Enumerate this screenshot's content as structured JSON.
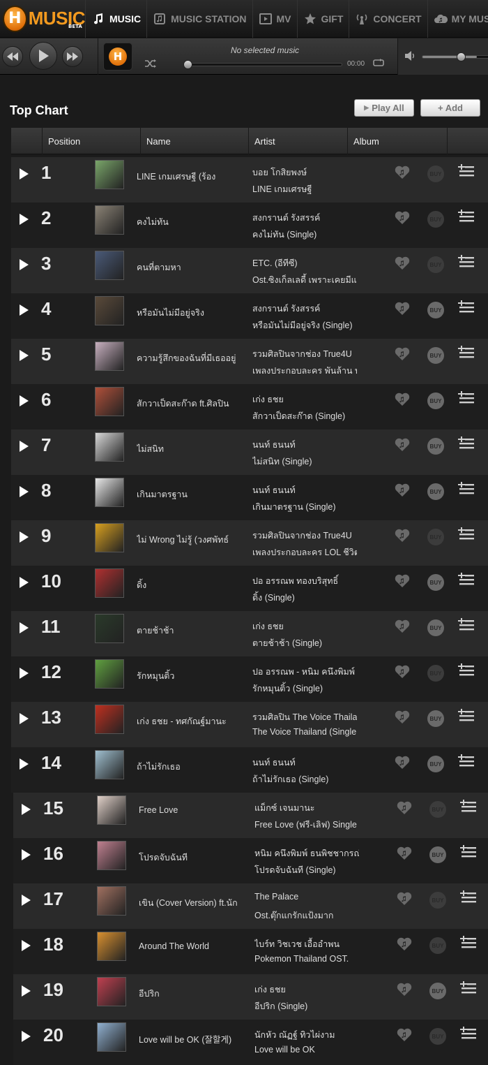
{
  "nav": {
    "logo_text": "MUSIC",
    "logo_badge": "BETA",
    "items": [
      {
        "label": "MUSIC",
        "icon": "music-note-icon",
        "active": true
      },
      {
        "label": "MUSIC STATION",
        "icon": "radio-station-icon",
        "active": false
      },
      {
        "label": "MV",
        "icon": "video-icon",
        "active": false
      },
      {
        "label": "GIFT",
        "icon": "star-icon",
        "active": false
      },
      {
        "label": "CONCERT",
        "icon": "broadcast-icon",
        "active": false
      },
      {
        "label": "MY MUSIC",
        "icon": "cloud-music-icon",
        "active": false
      }
    ]
  },
  "player": {
    "now_playing": "No selected music",
    "time": "00:00",
    "volume": 0.8
  },
  "chart": {
    "title": "Top Chart",
    "play_all_label": "Play All",
    "add_label": "+ Add",
    "columns": [
      "Position",
      "Name",
      "Artist",
      "Album"
    ],
    "rows": [
      {
        "pos": "1",
        "title": "LINE เกมเศรษฐี (ร้อง",
        "artist": "บอย โกสิยพงษ์",
        "album": "LINE เกมเศรษฐี",
        "buy": false,
        "cover": "#7aa66a"
      },
      {
        "pos": "2",
        "title": "คงไม่ทัน",
        "artist": "สงกรานต์ รังสรรค์",
        "album": "คงไม่ทัน (Single)",
        "buy": false,
        "cover": "#8a8275"
      },
      {
        "pos": "3",
        "title": "คนที่ตามหา",
        "artist": "ETC. (อีทีซี)",
        "album": "Ost.ซิงเก็ลเลดี้ เพราะเคยมีแ",
        "buy": false,
        "cover": "#4a5a78"
      },
      {
        "pos": "4",
        "title": "หรือมันไม่มีอยู่จริง",
        "artist": "สงกรานต์ รังสรรค์",
        "album": "หรือมันไม่มีอยู่จริง (Single)",
        "buy": true,
        "cover": "#5a4a3a"
      },
      {
        "pos": "5",
        "title": "ความรู้สึกของฉันที่มีเธออยู่",
        "artist": "รวมศิลปินจากช่อง True4U",
        "album": "เพลงประกอบละคร พันล้าน ท",
        "buy": true,
        "cover": "#c8b0c0"
      },
      {
        "pos": "6",
        "title": "สักวาเป็ดสะก๊าด ft.ศิลปิน",
        "artist": "เก่ง ธชย",
        "album": "สักวาเป็ดสะก๊าด (Single)",
        "buy": true,
        "cover": "#b0503a"
      },
      {
        "pos": "7",
        "title": "ไม่สนิท",
        "artist": "นนท์ ธนนท์",
        "album": "ไม่สนิท (Single)",
        "buy": true,
        "cover": "#d8d8d8"
      },
      {
        "pos": "8",
        "title": "เกินมาตรฐาน",
        "artist": "นนท์ ธนนท์",
        "album": "เกินมาตรฐาน (Single)",
        "buy": true,
        "cover": "#e8e8e8"
      },
      {
        "pos": "9",
        "title": "ไม่ Wrong ไม่รู้ (วงศพัทธ์",
        "artist": "รวมศิลปินจากช่อง True4U",
        "album": "เพลงประกอบละคร LOL ชีวิต",
        "buy": false,
        "cover": "#d8a020"
      },
      {
        "pos": "10",
        "title": "ดิ้ง",
        "artist": "ปอ อรรณพ ทองบริสุทธิ์",
        "album": "ดิ้ง (Single)",
        "buy": true,
        "cover": "#b03030"
      },
      {
        "pos": "11",
        "title": "ตายช้าช้า",
        "artist": "เก่ง ธชย",
        "album": "ตายช้าช้า (Single)",
        "buy": true,
        "cover": "#2a3a2a"
      },
      {
        "pos": "12",
        "title": "รักหมุนติ้ว",
        "artist": "ปอ อรรณพ - หนิม คนึงพิมพ์",
        "album": "รักหมุนติ้ว (Single)",
        "buy": false,
        "cover": "#60a040"
      },
      {
        "pos": "13",
        "title": "เก่ง ธชย - ทศกัณฐ์มานะ",
        "artist": "รวมศิลปิน The Voice Thailand",
        "album": "The Voice Thailand (Single",
        "buy": true,
        "cover": "#c03020"
      },
      {
        "pos": "14",
        "title": "ถ้าไม่รักเธอ",
        "artist": "นนท์ ธนนท์",
        "album": "ถ้าไม่รักเธอ (Single)",
        "buy": true,
        "cover": "#a0c0d0"
      },
      {
        "pos": "15",
        "title": "Free Love",
        "artist": "แม็กซ์ เจนมานะ",
        "album": "Free Love (ฟรี-เลิฟ) Single",
        "buy": false,
        "cover": "#e0d0c8"
      },
      {
        "pos": "16",
        "title": "โปรดจับฉันที",
        "artist": "หนิม คนึงพิมพ์ ธนพิชชากรณ์",
        "album": "โปรดจับฉันที (Single)",
        "buy": true,
        "cover": "#c08090"
      },
      {
        "pos": "17",
        "title": "เขิน (Cover Version) ft.นัก",
        "artist": "The Palace",
        "album": "Ost.ตุ๊กแกรักแป้งมาก",
        "buy": false,
        "cover": "#a07060"
      },
      {
        "pos": "18",
        "title": "Around The World",
        "artist": "ไบร์ท วิชเวช เอื้ออำพน",
        "album": "Pokemon Thailand OST.",
        "buy": false,
        "cover": "#d89030"
      },
      {
        "pos": "19",
        "title": "อีปริก",
        "artist": "เก่ง ธชย",
        "album": "อีปริก (Single)",
        "buy": true,
        "cover": "#c04050"
      },
      {
        "pos": "20",
        "title": "Love will be OK (잘할게)",
        "artist": "นักหัว ณัฏฐ์ ทิวไผ่งาม",
        "album": "Love will be OK",
        "buy": false,
        "cover": "#90b0d0"
      }
    ],
    "row_action_labels": {
      "buy": "BUY"
    }
  }
}
